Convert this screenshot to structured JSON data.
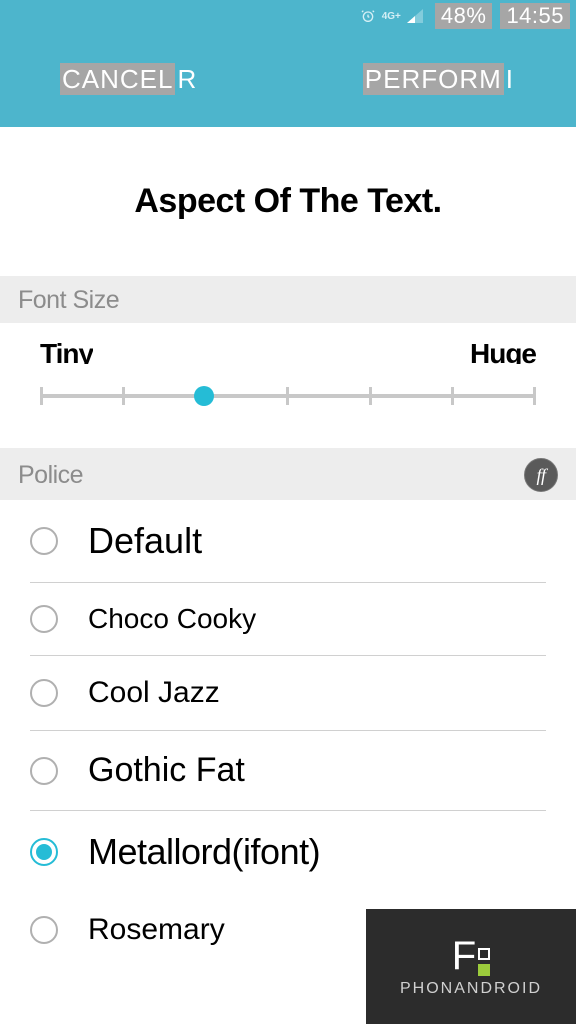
{
  "status_bar": {
    "network": "4G+",
    "battery": "48%",
    "time": "14:55"
  },
  "header": {
    "cancel_main": "CANCEL",
    "cancel_tail": "R",
    "perform_main": "PERFORM",
    "perform_tail": "I"
  },
  "preview": "Aspect Of The Text.",
  "sections": {
    "font_size": "Font Size",
    "police": "Police"
  },
  "slider": {
    "min_label": "Tiny",
    "max_label": "Huge",
    "position": 33,
    "ticks": 7
  },
  "fonts": [
    {
      "name": "Default",
      "selected": false
    },
    {
      "name": "Choco Cooky",
      "selected": false
    },
    {
      "name": "Cool Jazz",
      "selected": false
    },
    {
      "name": "Gothic Fat",
      "selected": false
    },
    {
      "name": "Metallord(ifont)",
      "selected": true
    },
    {
      "name": "Rosemary",
      "selected": false
    }
  ],
  "watermark": {
    "text": "PHONANDROID"
  }
}
